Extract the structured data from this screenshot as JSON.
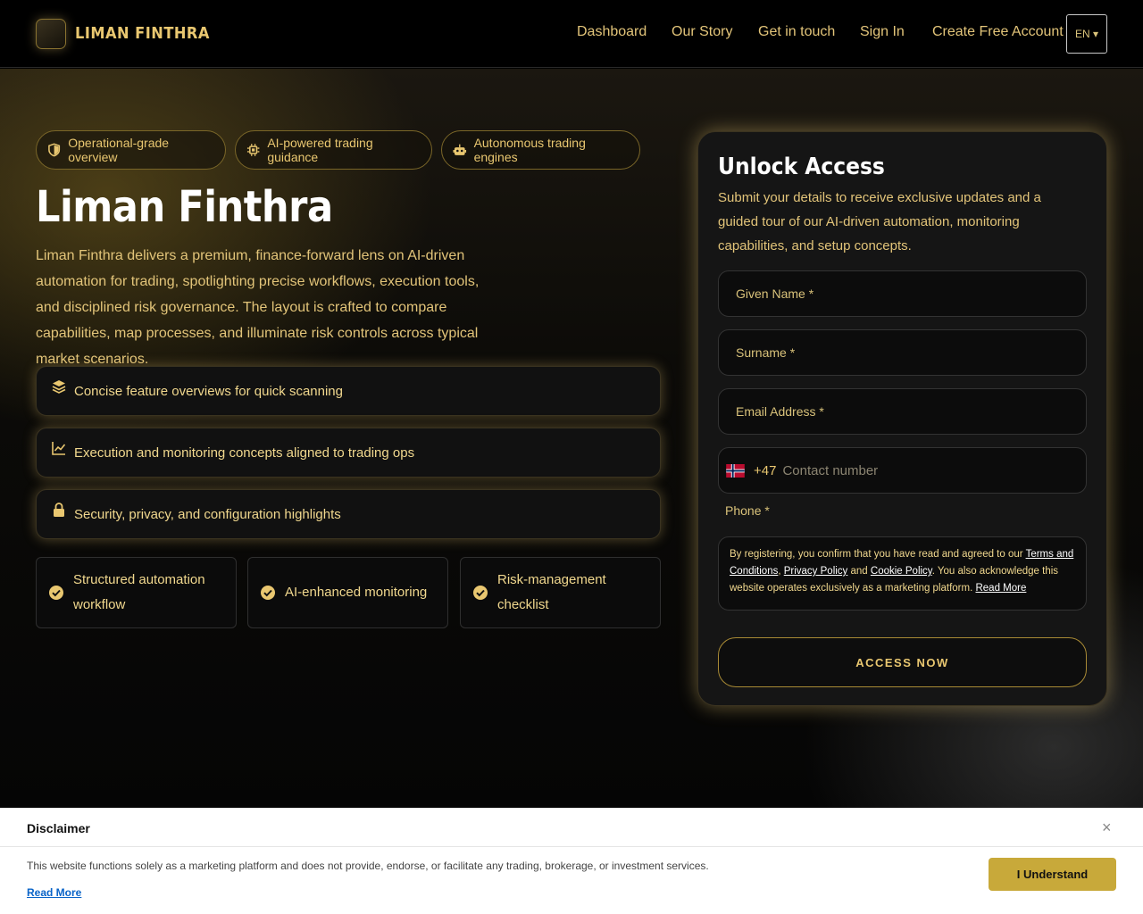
{
  "header": {
    "brand": "LIMAN FINTHRA",
    "nav": [
      "Dashboard",
      "Our Story",
      "Get in touch",
      "Sign In",
      "Create Free Account"
    ],
    "lang": "EN ▾"
  },
  "hero": {
    "pills": [
      "Operational-grade overview",
      "AI-powered trading guidance",
      "Autonomous trading engines"
    ],
    "title": "Liman Finthra",
    "lead": "Liman Finthra delivers a premium, finance-forward lens on AI-driven automation for trading, spotlighting precise workflows, execution tools, and disciplined risk governance. The layout is crafted to compare capabilities, map processes, and illuminate risk controls across typical market scenarios.",
    "features": [
      "Concise feature overviews for quick scanning",
      "Execution and monitoring concepts aligned to trading ops",
      "Security, privacy, and configuration highlights"
    ],
    "checks": [
      "Structured automation workflow",
      "AI-enhanced monitoring",
      "Risk-management checklist"
    ]
  },
  "form": {
    "title": "Unlock Access",
    "subtitle": "Submit your details to receive exclusive updates and a guided tour of our AI-driven automation, monitoring capabilities, and setup concepts.",
    "given_name": "Given Name *",
    "surname": "Surname *",
    "email": "Email Address *",
    "dial_code": "+47",
    "phone_placeholder": "Contact number",
    "phone_label": "Phone *",
    "terms_prefix": "By registering, you confirm that you have read and agreed to our ",
    "terms_link": "Terms and Conditions",
    "privacy_link": "Privacy Policy",
    "and": " and ",
    "cookie_link": "Cookie Policy",
    "terms_suffix": ". You also acknowledge this website operates exclusively as a marketing platform. ",
    "read_more": "Read More",
    "button": "ACCESS NOW"
  },
  "disclaimer": {
    "title": "Disclaimer",
    "close": "×",
    "text": "This website functions solely as a marketing platform and does not provide, endorse, or facilitate any trading, brokerage, or investment services.",
    "read_more": "Read More",
    "button": "I Understand"
  },
  "colors": {
    "gold": "#e9c770",
    "button": "#c8a93a"
  }
}
